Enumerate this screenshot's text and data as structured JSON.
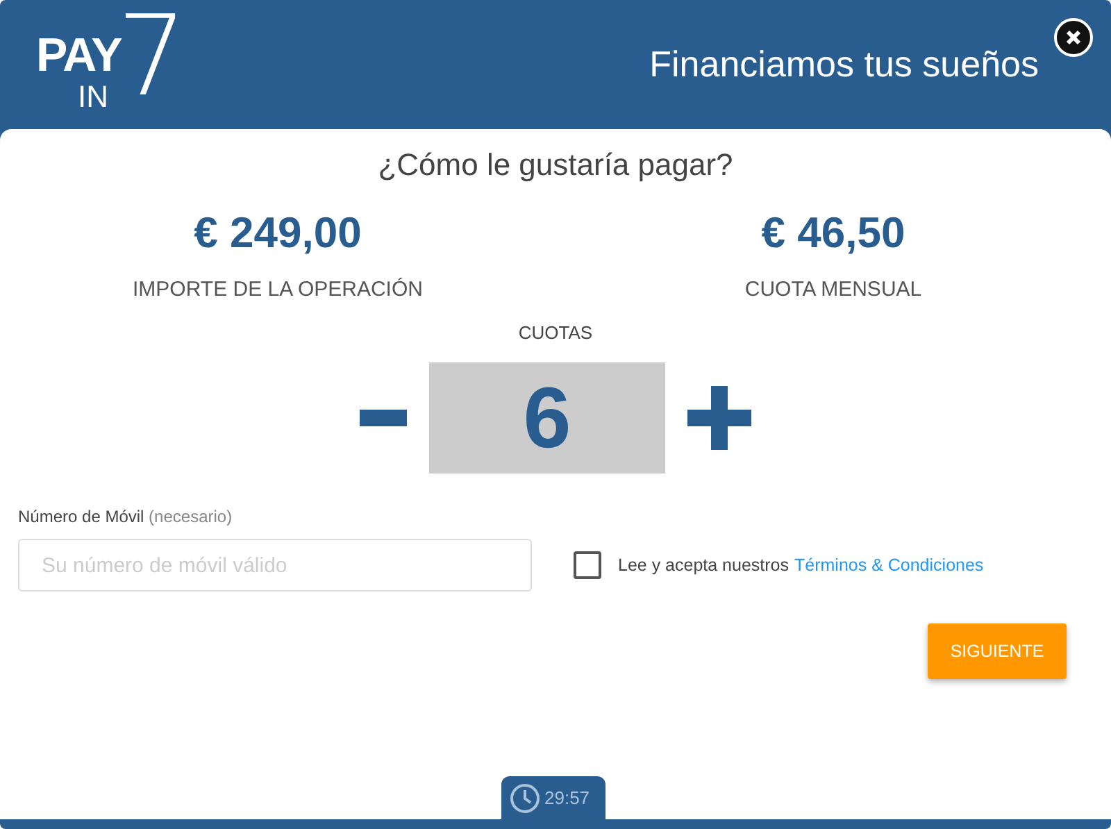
{
  "header": {
    "logo": {
      "top": "PAY",
      "bottom": "IN",
      "digit": "7"
    },
    "title": "Financiamos tus sueños"
  },
  "question": "¿Cómo le gustaría pagar?",
  "amounts": [
    {
      "value": "€ 249,00",
      "label": "IMPORTE DE LA OPERACIÓN"
    },
    {
      "value": "€ 46,50",
      "label": "CUOTA MENSUAL"
    }
  ],
  "installments": {
    "label": "CUOTAS",
    "value": "6"
  },
  "phone": {
    "label": "Número de Móvil",
    "hint": "(necesario)",
    "placeholder": "Su número de móvil válido"
  },
  "terms": {
    "checked": false,
    "text": "Lee y acepta nuestros",
    "link": "Términos & Condiciones"
  },
  "next_button": "SIGUIENTE",
  "timer": "29:57"
}
